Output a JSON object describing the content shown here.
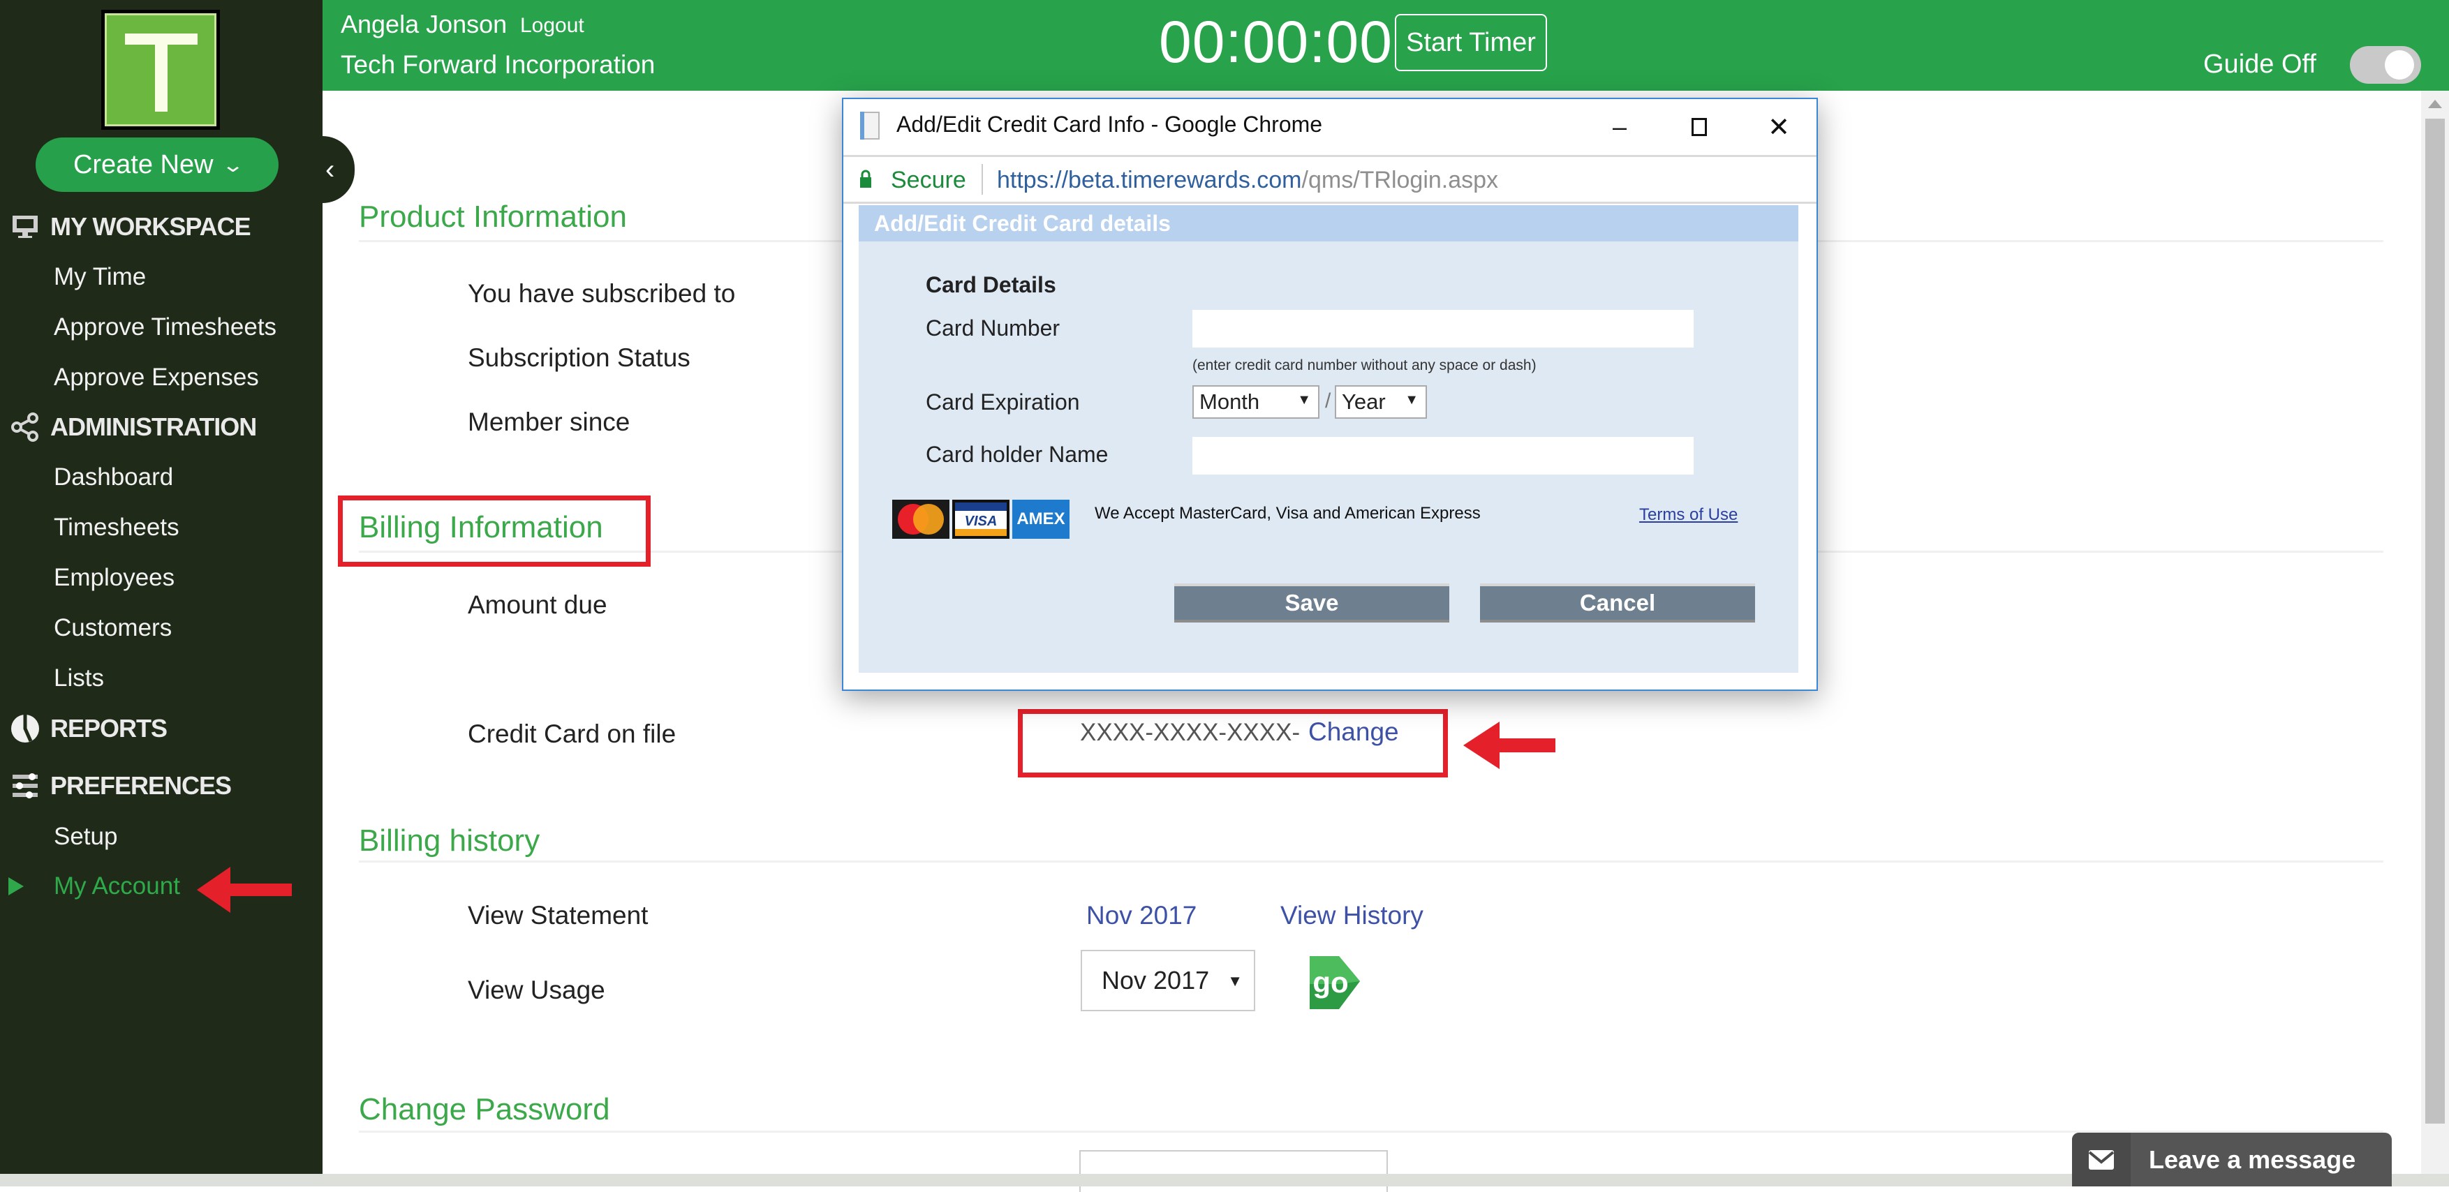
{
  "sidebar": {
    "create_new_label": "Create New",
    "sections": [
      {
        "title": "MY WORKSPACE",
        "icon": "monitor-icon",
        "items": [
          "My Time",
          "Approve Timesheets",
          "Approve Expenses"
        ]
      },
      {
        "title": "ADMINISTRATION",
        "icon": "share-icon",
        "items": [
          "Dashboard",
          "Timesheets",
          "Employees",
          "Customers",
          "Lists"
        ]
      },
      {
        "title": "REPORTS",
        "icon": "pie-chart-icon",
        "items": []
      },
      {
        "title": "PREFERENCES",
        "icon": "sliders-icon",
        "items": [
          "Setup",
          "My Account"
        ]
      }
    ],
    "active_item": "My Account"
  },
  "header": {
    "user_name": "Angela Jonson",
    "logout_label": "Logout",
    "company": "Tech Forward Incorporation",
    "timer": "00:00:00",
    "start_timer_label": "Start Timer",
    "guide_label": "Guide Off",
    "guide_on": false
  },
  "main": {
    "product_info": {
      "title": "Product Information",
      "fields": [
        "You have subscribed to",
        "Subscription Status",
        "Member since"
      ]
    },
    "billing_info": {
      "title": "Billing Information",
      "amount_due_label": "Amount due",
      "credit_card_label": "Credit Card on file",
      "credit_card_masked": "XXXX-XXXX-XXXX-",
      "change_link": "Change"
    },
    "billing_history": {
      "title": "Billing history",
      "view_statement_label": "View Statement",
      "statement_link": "Nov 2017",
      "view_history_link": "View History",
      "view_usage_label": "View Usage",
      "usage_selected": "Nov 2017",
      "go_label": "go"
    },
    "change_password": {
      "title": "Change Password"
    }
  },
  "popup": {
    "window_title": "Add/Edit Credit Card Info - Google Chrome",
    "secure_label": "Secure",
    "url_host": "https://beta.timerewards.com",
    "url_path": "/qms/TRlogin.aspx",
    "header": "Add/Edit Credit Card details",
    "card_details_title": "Card Details",
    "card_number_label": "Card Number",
    "card_number_value": "",
    "card_number_hint": "(enter credit card number without any space or dash)",
    "card_expiration_label": "Card Expiration",
    "month_selected": "Month",
    "year_selected": "Year",
    "expiration_separator": "/",
    "card_holder_label": "Card holder Name",
    "card_holder_value": "",
    "accept_text": "We Accept MasterCard, Visa and American Express",
    "card_brands": [
      "MasterCard",
      "VISA",
      "AMEX"
    ],
    "terms_link": "Terms of Use",
    "save_label": "Save",
    "cancel_label": "Cancel"
  },
  "chat": {
    "leave_message_label": "Leave a message"
  },
  "colors": {
    "brand_green": "#28a24b",
    "sidebar_bg": "#1f2a18",
    "section_title": "#3ba84a",
    "link_blue": "#3d52a6",
    "annotation_red": "#e4202a"
  }
}
